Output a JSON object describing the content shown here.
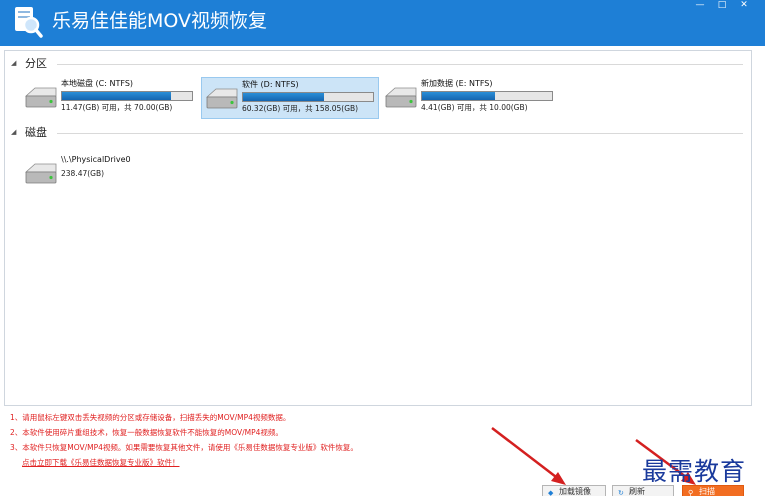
{
  "window": {
    "title": "乐易佳佳能MOV视频恢复",
    "controls": {
      "minimize": "—",
      "maximize": "□",
      "close": "✕"
    }
  },
  "groups": {
    "partition": "分区",
    "disk": "磁盘"
  },
  "partitions": [
    {
      "name": "本地磁盘 (C: NTFS)",
      "size": "11.47(GB) 可用，共 70.00(GB)",
      "used_fraction": 0.84,
      "selected": false
    },
    {
      "name": "软件 (D: NTFS)",
      "size": "60.32(GB) 可用，共 158.05(GB)",
      "used_fraction": 0.62,
      "selected": true
    },
    {
      "name": "新加数据 (E: NTFS)",
      "size": "4.41(GB) 可用，共 10.00(GB)",
      "used_fraction": 0.56,
      "selected": false
    }
  ],
  "disks": [
    {
      "name": "\\\\.\\PhysicalDrive0",
      "size": "238.47(GB)"
    }
  ],
  "hints": [
    "1、请用鼠标左键双击丢失视频的分区或存储设备，扫描丢失的MOV/MP4视频数据。",
    "2、本软件使用碎片重组技术，恢复一般数据恢复软件不能恢复的MOV/MP4视频。",
    "3、本软件只恢复MOV/MP4视频。如果需要恢复其他文件，请使用《乐易佳数据恢复专业版》软件恢复。"
  ],
  "hint_link": "点击立即下载《乐易佳数据恢复专业版》软件！",
  "buttons": {
    "load_image": "加载镜像",
    "refresh": "刷新",
    "scan": "扫描"
  },
  "watermark": "最需教育",
  "colors": {
    "titlebar": "#1e7fd6",
    "selection": "#cce4f7",
    "bar_fill": "#1e7fd6",
    "hint_text": "#e02020",
    "primary_button": "#f26d21",
    "arrow": "#d42020"
  }
}
